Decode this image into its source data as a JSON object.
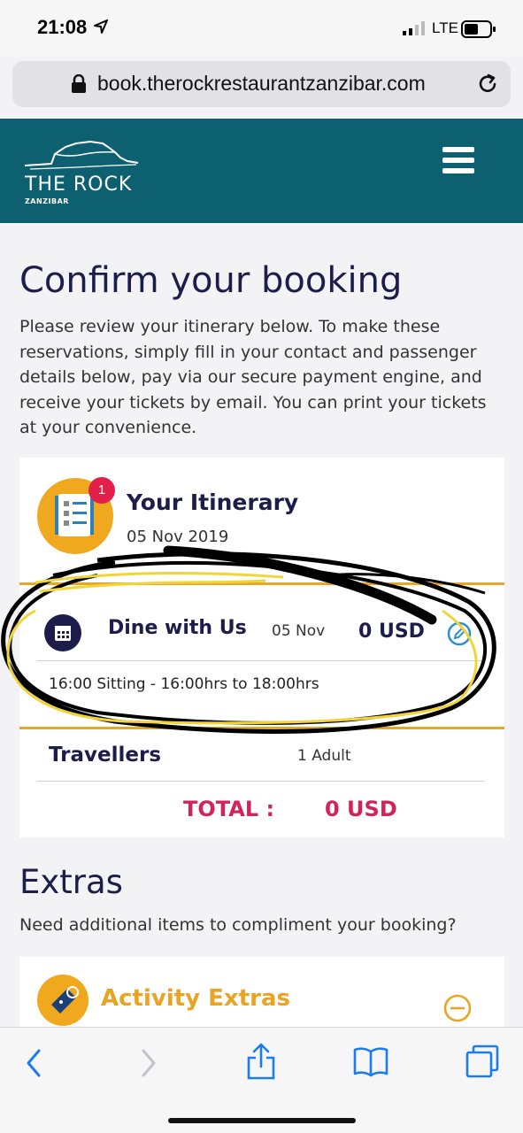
{
  "status_bar": {
    "time": "21:08",
    "network": "LTE"
  },
  "browser": {
    "url": "book.therockrestaurantzanzibar.com"
  },
  "site": {
    "logo_title": "THE ROCK",
    "logo_subtitle": "ZANZIBAR",
    "header_color": "#0c6070"
  },
  "page": {
    "title": "Confirm your booking",
    "intro": "Please review your itinerary below. To make these reservations, simply fill in your contact and passenger details below, pay via our secure payment engine, and receive your tickets by email. You can print your tickets at your convenience."
  },
  "itinerary": {
    "badge_count": "1",
    "title": "Your Itinerary",
    "date": "05 Nov 2019",
    "item": {
      "title": "Dine with Us",
      "date": "05 Nov",
      "price": "0 USD",
      "detail": "16:00 Sitting - 16:00hrs to 18:00hrs"
    },
    "travellers_label": "Travellers",
    "travellers_value": "1 Adult",
    "total_label": "TOTAL :",
    "total_value": "0 USD"
  },
  "extras": {
    "title": "Extras",
    "subtitle": "Need additional items to compliment your booking?",
    "card_title": "Activity Extras"
  },
  "colors": {
    "accent_gold": "#e5a826",
    "total_red": "#d0245a",
    "navy": "#1c1d4a"
  }
}
